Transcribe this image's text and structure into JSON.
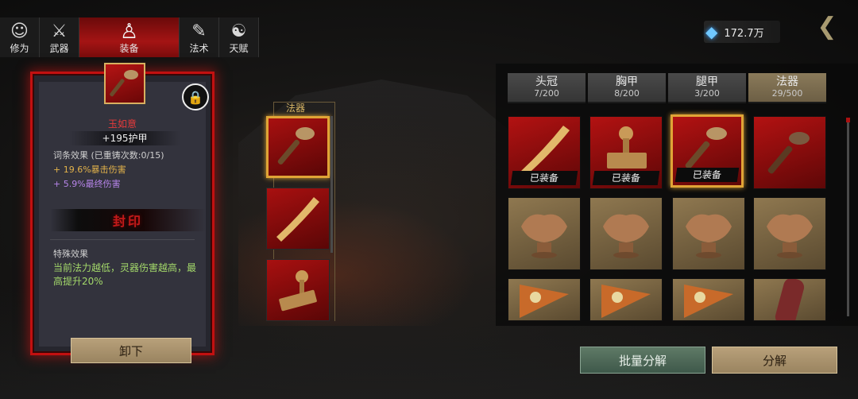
{
  "tabs": [
    {
      "label": "修为",
      "icon": "cultivator-icon"
    },
    {
      "label": "武器",
      "icon": "sword-icon"
    },
    {
      "label": "装备",
      "icon": "robe-icon",
      "active": true
    },
    {
      "label": "法术",
      "icon": "scroll-icon"
    },
    {
      "label": "天赋",
      "icon": "taiji-icon"
    }
  ],
  "currency": {
    "amount": "172.7万",
    "icon": "spirit-crystal-icon"
  },
  "detail": {
    "name": "玉如意",
    "stat": "+195护甲",
    "affix_title": "词条效果 (已重铸次数:0/15)",
    "affix_1": "+ 19.6%暴击伤害",
    "affix_2": "+ 5.9%最终伤害",
    "seal": "封印",
    "special_title": "特殊效果",
    "special_desc": "当前法力越低，灵器伤害越高，最高提升20%",
    "unequip_label": "卸下"
  },
  "middle": {
    "title": "法器"
  },
  "categories": [
    {
      "name": "头冠",
      "count": "7/200"
    },
    {
      "name": "胸甲",
      "count": "8/200"
    },
    {
      "name": "腿甲",
      "count": "3/200"
    },
    {
      "name": "法器",
      "count": "29/500",
      "active": true
    }
  ],
  "equipped_tag": "已装备",
  "buttons": {
    "batch": "批量分解",
    "decompose": "分解"
  },
  "colors": {
    "accent_red": "#c21010",
    "gold": "#e0a436",
    "buff_gold": "#e2b24a",
    "buff_purple": "#b785ea",
    "special_green": "#a3d86a"
  }
}
